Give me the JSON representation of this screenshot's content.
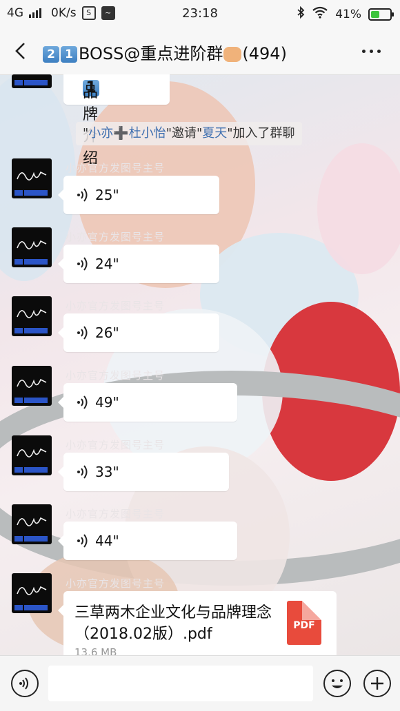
{
  "status_bar": {
    "network": "4G",
    "speed": "0K/s",
    "time": "23:18",
    "battery": "41%"
  },
  "nav": {
    "title_num1": "2",
    "title_num2": "1",
    "title_text": "BOSS@重点进阶群",
    "member_count": "(494)",
    "back_icon": "chevron-left-icon",
    "more_icon": "more-dots-icon"
  },
  "top_message": {
    "num": "1",
    "text": "品牌介绍"
  },
  "system_message": {
    "quote1": "\"",
    "user1": "小亦",
    "plus": "➕",
    "user2": "杜小怡",
    "mid": "\"邀请\"",
    "user3": "夏天",
    "tail": "\"加入了群聊"
  },
  "messages": [
    {
      "sender": "小亦官方发图号主号",
      "duration": "25\""
    },
    {
      "sender": "小亦官方发图号主号",
      "duration": "24\""
    },
    {
      "sender": "小亦官方发图号主号",
      "duration": "26\""
    },
    {
      "sender": "小亦官方发图号主号",
      "duration": "49\""
    },
    {
      "sender": "小亦官方发图号主号",
      "duration": "33\""
    },
    {
      "sender": "小亦官方发图号主号",
      "duration": "44\""
    }
  ],
  "file_message": {
    "sender": "小亦官方发图号主号",
    "file_name": "三草两木企业文化与品牌理念（2018.02版）.pdf",
    "file_size": "13.6 MB",
    "file_type": "PDF"
  },
  "input_bar": {
    "voice_icon": "voice-icon",
    "emoji_icon": "emoji-icon",
    "plus_icon": "plus-icon"
  },
  "colors": {
    "link_blue": "#3f6fb0",
    "pdf_red": "#e84b3c",
    "battery_green": "#3cc43c"
  }
}
